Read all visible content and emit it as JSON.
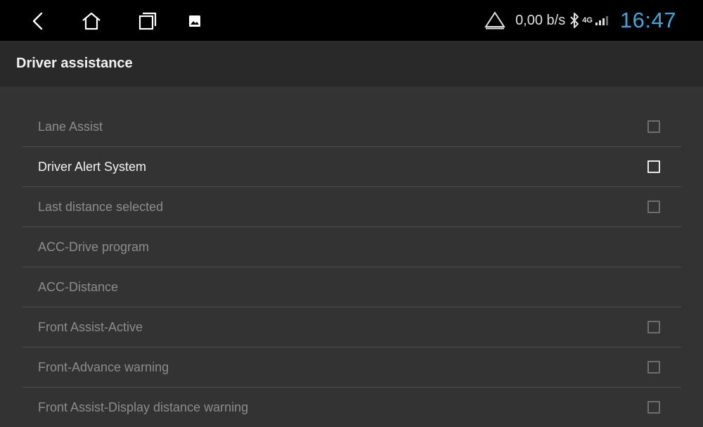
{
  "statusbar": {
    "nav_icons": [
      "back-icon",
      "home-icon",
      "recents-icon",
      "gallery-icon"
    ],
    "status_icons": [
      "warning-triangle-icon",
      "bluetooth-icon",
      "signal-icon"
    ],
    "network_speed": "0,00 b/s",
    "network_type": "4G",
    "clock": "16:47",
    "clock_color": "#3ea6dc"
  },
  "header": {
    "title": "Driver assistance"
  },
  "settings": {
    "items": [
      {
        "label": "Lane Assist",
        "checkbox": true,
        "checked": false,
        "enabled": false
      },
      {
        "label": "Driver Alert System",
        "checkbox": true,
        "checked": false,
        "enabled": true
      },
      {
        "label": "Last distance selected",
        "checkbox": true,
        "checked": false,
        "enabled": false
      },
      {
        "label": "ACC-Drive program",
        "checkbox": false,
        "enabled": false
      },
      {
        "label": "ACC-Distance",
        "checkbox": false,
        "enabled": false
      },
      {
        "label": "Front Assist-Active",
        "checkbox": true,
        "checked": false,
        "enabled": false
      },
      {
        "label": "Front-Advance warning",
        "checkbox": true,
        "checked": false,
        "enabled": false
      },
      {
        "label": "Front Assist-Display distance warning",
        "checkbox": true,
        "checked": false,
        "enabled": false
      }
    ]
  }
}
